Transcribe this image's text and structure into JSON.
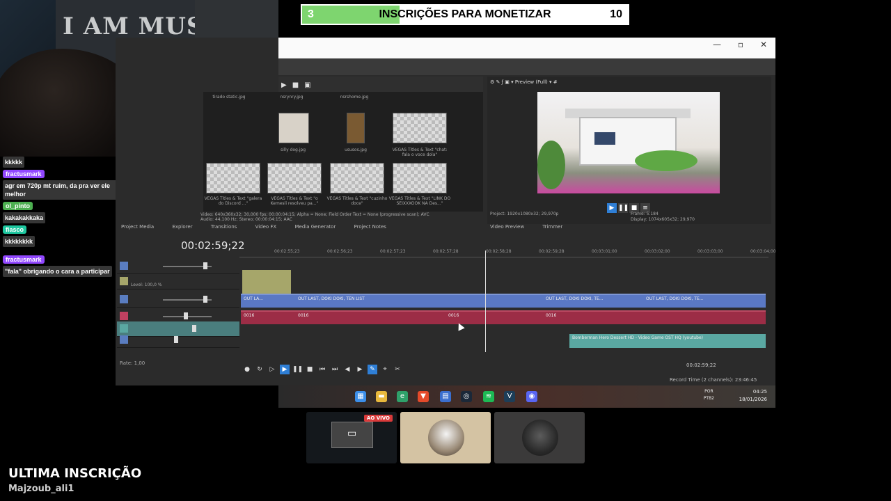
{
  "webcam": {
    "wall_text": "I AM MUSIC"
  },
  "goal": {
    "current": "3",
    "title": "INSCRIÇÕES PARA MONETIZAR",
    "target": "10",
    "progress_fraction": 0.3,
    "fill_color": "#7ed56f"
  },
  "chat": [
    {
      "type": "msg",
      "text": "kkkkk"
    },
    {
      "type": "user",
      "text": "fractusmark",
      "color": "#9147ff"
    },
    {
      "type": "msg",
      "text": "agr em 720p mt ruim, da pra ver ele melhor"
    },
    {
      "type": "user",
      "text": "ol_pinto",
      "color": "#4caf50"
    },
    {
      "type": "msg",
      "text": "kakakakkaka"
    },
    {
      "type": "user",
      "text": "fiasco",
      "color": "#1ec8a0"
    },
    {
      "type": "msg",
      "text": "kkkkkkkk"
    },
    {
      "type": "user",
      "text": "fractusmark",
      "color": "#9147ff"
    },
    {
      "type": "msg",
      "text": "\"fala\" obrigando o cara a participar"
    }
  ],
  "vegas": {
    "media": [
      {
        "label": "tirado static.jpg"
      },
      {
        "label": "nsrynry.jpg"
      },
      {
        "label": "nsrshome.jpg"
      },
      {
        "label": "silly dog.jpg"
      },
      {
        "label": "ususos.jpg"
      },
      {
        "label": "VEGAS Titles & Text \"chat: fala o voce dola\""
      },
      {
        "label": "VEGAS Titles & Text \"galera do Discord ...\""
      },
      {
        "label": "VEGAS Titles & Text \"o Kemesli resolveu pa...\""
      },
      {
        "label": "VEGAS Titles & Text \"cuzinho doce\""
      },
      {
        "label": "VEGAS Titles & Text \"LINK DO SEIXXXOOK NA Des...\""
      }
    ],
    "media_info": "Video: 640x360x32; 30,000 fps; 00:00:04:15; Alpha = None; Field Order Text = None (progressive scan); AVC",
    "media_info2": "Audio: 44,100 Hz; Stereo; 00:00:04:15; AAC",
    "preview_label": "Preview (Full)",
    "preview_project": "Project: 1920x1080x32; 29,970p",
    "preview_frame": "Frame: 5.184",
    "preview_display": "Display: 1074x605x32; 29,970",
    "media_tabs": [
      "Project Media",
      "Explorer",
      "Transitions",
      "Video FX",
      "Media Generator",
      "Project Notes"
    ],
    "preview_tabs": [
      "Video Preview",
      "Trimmer"
    ],
    "timecode": "00:02:59;22",
    "ruler_marks": [
      "00:02:55;23",
      "00:02:56;23",
      "00:02:57;23",
      "00:02:57;28",
      "00:02:58;28",
      "00:02:59;28",
      "00:03:01;00",
      "00:03:02;00",
      "00:03:03;00",
      "00:03:04;00"
    ],
    "level": "Level: 100,0 %",
    "clips_video": [
      "OUT LA...",
      "OUT LAST, DOKI DOKI, TEN LIST",
      "OUT LAST, DOKI DOKI, TE...",
      "OUT LAST, DOKI DOKI, TE..."
    ],
    "clips_audio": [
      "0016",
      "0016",
      "0016",
      "0016"
    ],
    "music_clip": "Bomberman Hero Dessert HD - Video Game OST HQ (youtube)",
    "rate": "Rate: 1,00",
    "time_display": "00:02:59;22",
    "record_time": "Record Time (2 channels): 23:46:45"
  },
  "taskbar": {
    "lang": "POR",
    "layout": "PTB2",
    "time": "04:25",
    "date": "18/01/2026"
  },
  "tiles": {
    "live_label": "AO VIVO"
  },
  "last_sub": {
    "title": "ULTIMA INSCRIÇÃO",
    "name": "Majzoub_ali1"
  }
}
